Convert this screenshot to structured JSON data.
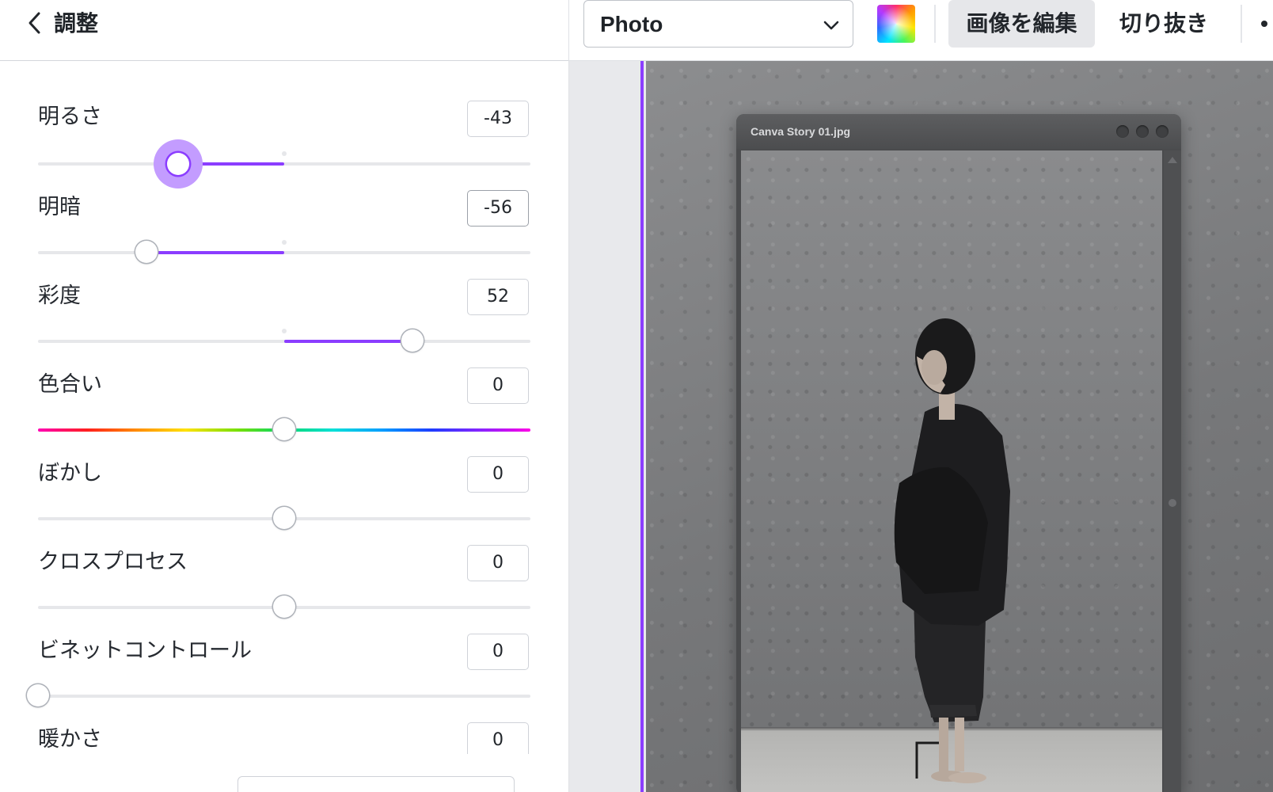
{
  "panel": {
    "back_label": "戻る",
    "title": "調整"
  },
  "adjustments": [
    {
      "label": "明るさ",
      "value": "-43"
    },
    {
      "label": "明暗",
      "value": "-56"
    },
    {
      "label": "彩度",
      "value": "52"
    },
    {
      "label": "色合い",
      "value": "0"
    },
    {
      "label": "ぼかし",
      "value": "0"
    },
    {
      "label": "クロスプロセス",
      "value": "0"
    },
    {
      "label": "ビネットコントロール",
      "value": "0"
    },
    {
      "label": "暖かさ",
      "value": "0"
    }
  ],
  "toolbar": {
    "filter_select": "Photo",
    "edit_image": "画像を編集",
    "crop": "切り抜き"
  },
  "canvas": {
    "window_title": "Canva Story 01.jpg"
  },
  "colors": {
    "accent": "#8b3dff"
  }
}
